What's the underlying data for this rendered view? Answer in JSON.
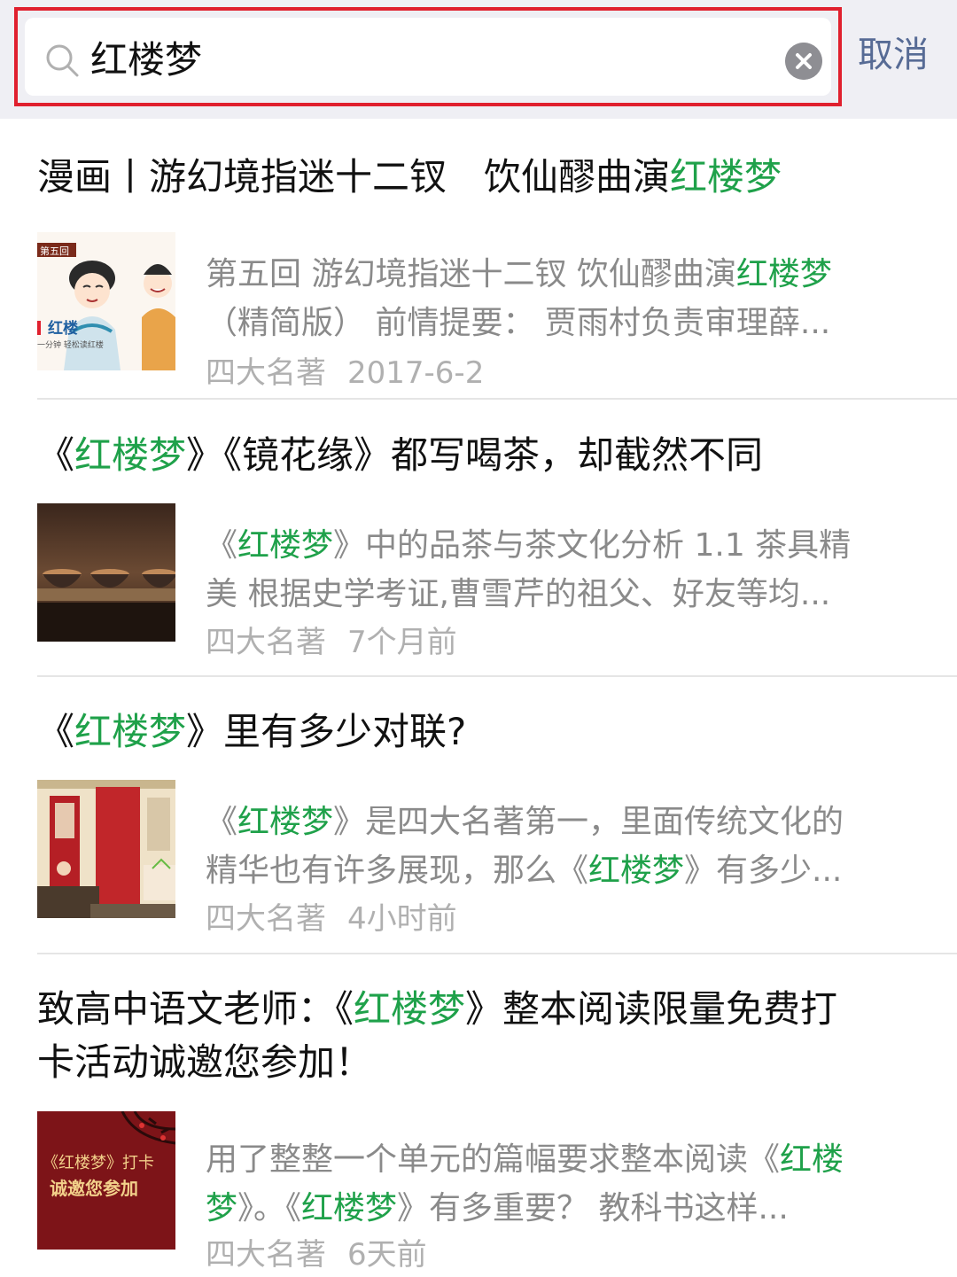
{
  "search": {
    "query": "红楼梦",
    "cancel_label": "取消"
  },
  "colors": {
    "highlight": "#1fa14a",
    "search_border": "#e0202e",
    "cancel": "#576b95"
  },
  "results": [
    {
      "title_parts": [
        "漫画丨游幻境指迷十二钗　饮仙醪曲演",
        "红楼梦",
        ""
      ],
      "snippet_line1_parts": [
        "第五回 游幻境指迷十二钗 饮仙醪曲演",
        "红楼梦",
        ""
      ],
      "snippet_line2": "（精简版） 前情提要： 贾雨村负责审理薛...",
      "source": "四大名著",
      "date": "2017-6-2",
      "thumb": "cartoon-thumbnail",
      "thumb_text_1": "第五回",
      "thumb_text_2": "红楼",
      "thumb_text_3": "一分钟 轻松读红楼"
    },
    {
      "title_parts": [
        "《",
        "红楼梦",
        "》《镜花缘》都写喝茶，却截然不同"
      ],
      "snippet_line1_parts": [
        "《",
        "红楼梦",
        "》中的品茶与茶文化分析 1.1 茶具精"
      ],
      "snippet_line2": "美 根据史学考证,曹雪芹的祖父、好友等均...",
      "source": "四大名著",
      "date": "7个月前",
      "thumb": "tea-cups-thumbnail"
    },
    {
      "title_parts": [
        "《",
        "红楼梦",
        "》里有多少对联?"
      ],
      "snippet_line1_parts": [
        "《",
        "红楼梦",
        "》是四大名著第一，里面传统文化的"
      ],
      "snippet_line2_parts": [
        "精华也有许多展现，那么《",
        "红楼梦",
        "》有多少..."
      ],
      "source": "四大名著",
      "date": "4小时前",
      "thumb": "painting-thumbnail"
    },
    {
      "title_line1_parts": [
        "致高中语文老师：《",
        "红楼梦",
        "》整本阅读限量免费打"
      ],
      "title_line2": "卡活动诚邀您参加！",
      "snippet_line1_parts": [
        "用了整整一个单元的篇幅要求整本阅读《",
        "红楼",
        ""
      ],
      "snippet_line2_parts": [
        "",
        "梦",
        "》。《",
        "红楼梦",
        "》有多重要？ 教科书这样..."
      ],
      "source": "四大名著",
      "date": "6天前",
      "thumb": "red-poster-thumbnail",
      "thumb_text_1": "《红楼梦》打卡",
      "thumb_text_2": "诚邀您参加"
    }
  ]
}
